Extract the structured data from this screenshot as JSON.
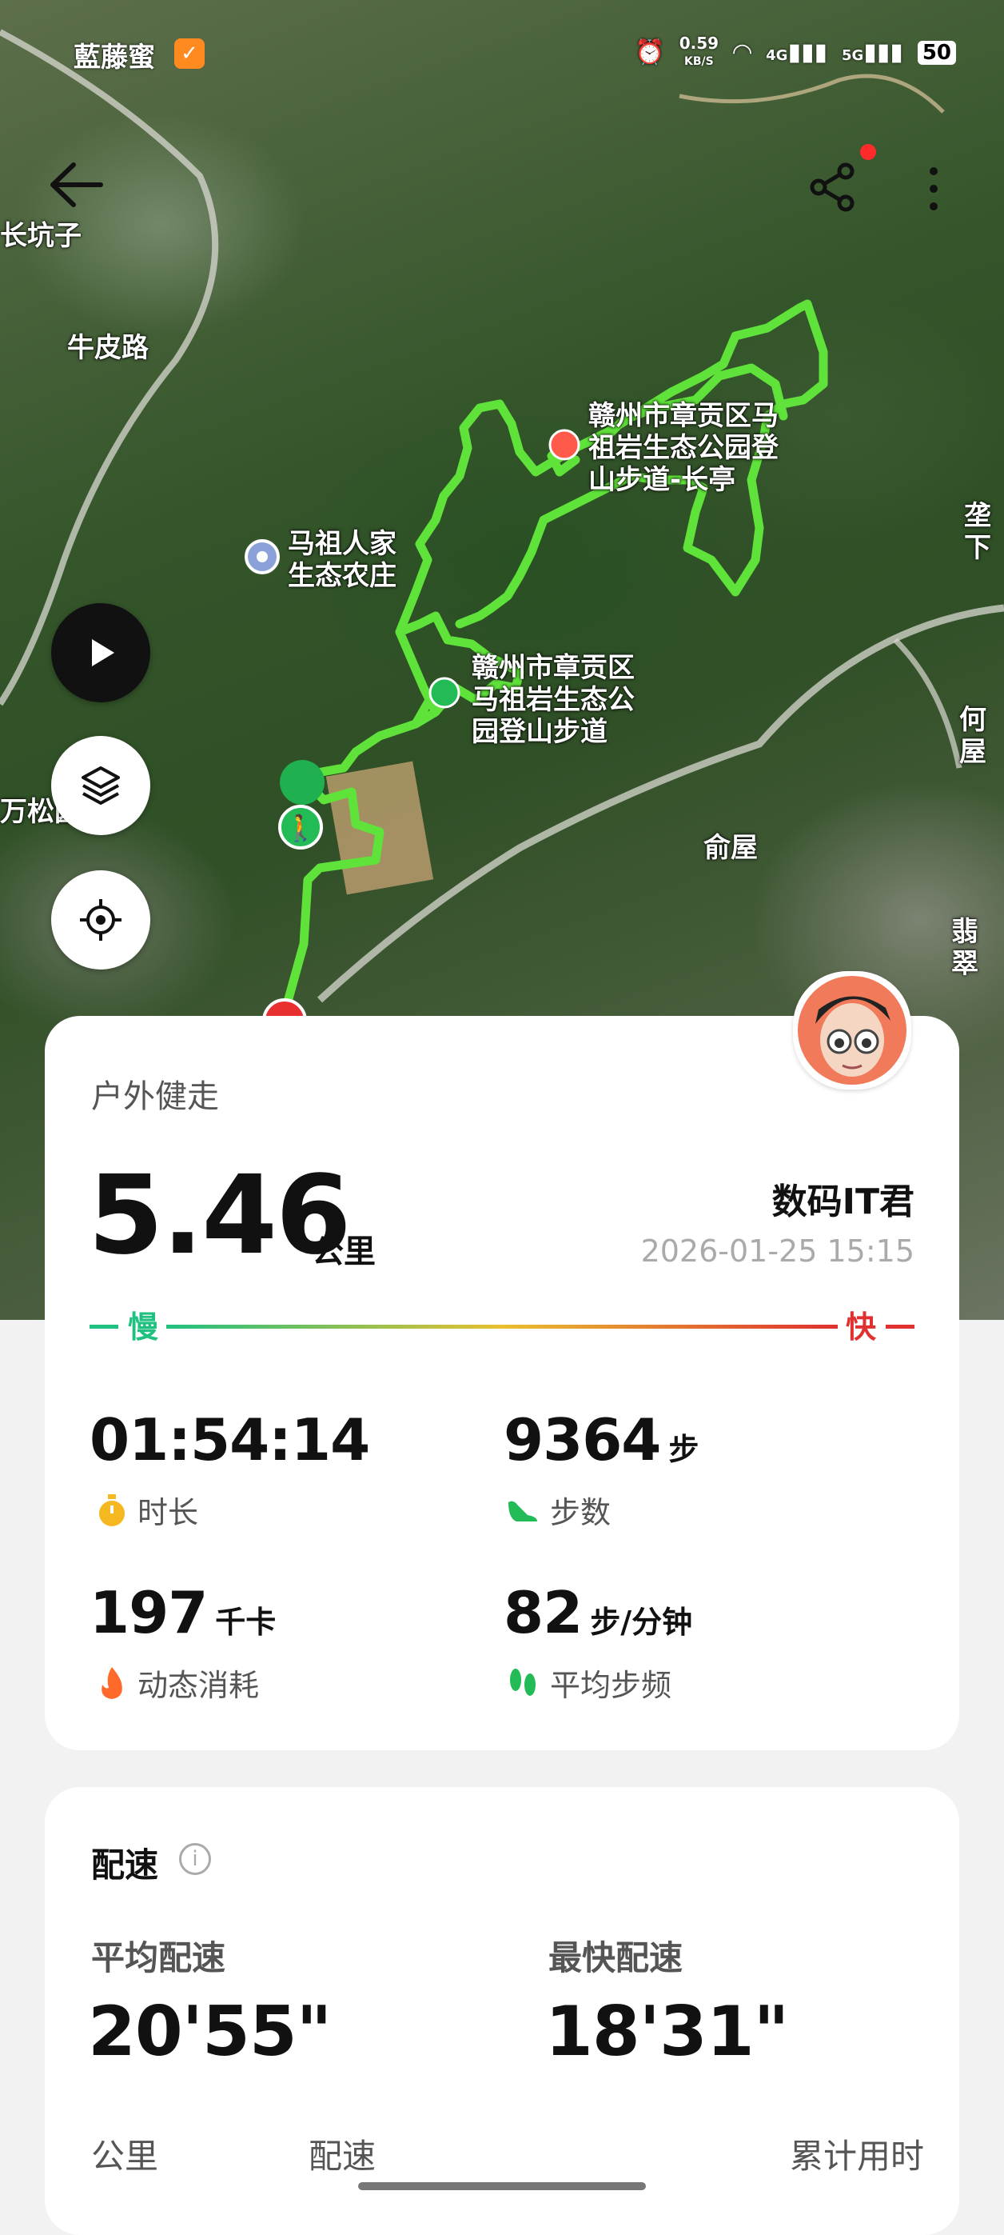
{
  "status_bar": {
    "carrier": "藍藤蜜",
    "net_speed_value": "0.59",
    "net_speed_unit": "KB/S",
    "signal1": "4G",
    "signal2": "5G",
    "battery": "50"
  },
  "map": {
    "labels": [
      "长坑子",
      "牛皮路",
      "马祖人家\n生态农庄",
      "赣州市章贡区马\n祖岩生态公园登\n山步道-长亭",
      "赣州市章贡区\n马祖岩生态公\n园登山步道",
      "万松园",
      "俞屋",
      "垄下",
      "何屋",
      "翡翠"
    ]
  },
  "summary": {
    "sport_type": "户外健走",
    "distance": "5.46",
    "distance_unit": "公里",
    "username": "数码IT君",
    "datetime": "2026-01-25 15:15",
    "slow_label": "慢",
    "fast_label": "快",
    "colors": {
      "slow": "#20c080",
      "mid": "#e8c030",
      "fast": "#e03030"
    }
  },
  "stats": {
    "duration": {
      "value": "01:54:14",
      "label": "时长"
    },
    "steps": {
      "value": "9364",
      "unit": "步",
      "label": "步数"
    },
    "calories": {
      "value": "197",
      "unit": "千卡",
      "label": "动态消耗"
    },
    "cadence": {
      "value": "82",
      "unit": "步/分钟",
      "label": "平均步频"
    }
  },
  "pace": {
    "title": "配速",
    "info_icon": "i",
    "avg_label": "平均配速",
    "avg_value": "20'55\"",
    "best_label": "最快配速",
    "best_value": "18'31\"",
    "columns": [
      "公里",
      "配速",
      "累计用时"
    ]
  }
}
